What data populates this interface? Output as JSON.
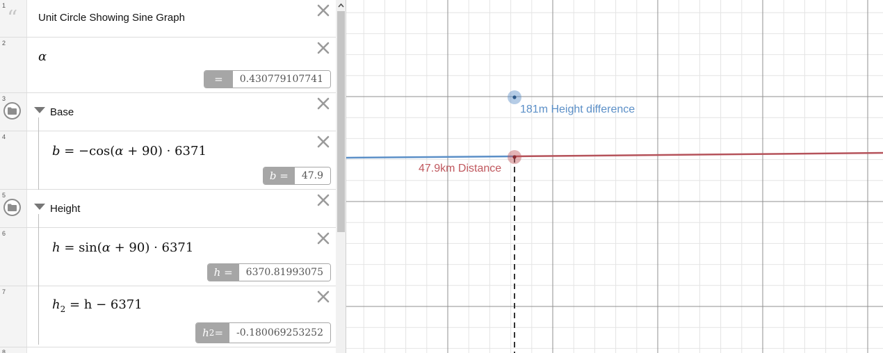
{
  "expressions": {
    "row1": {
      "number": "1",
      "note": "Unit Circle Showing Sine Graph"
    },
    "row2": {
      "number": "2",
      "var": "α",
      "eval_label": "=",
      "eval_value": "0.430779107741"
    },
    "row3": {
      "number": "3",
      "folder_title": "Base"
    },
    "row4": {
      "number": "4",
      "lhs": "b",
      "eq": " = −cos(",
      "alpha": "α",
      "rest": " + 90) · 6371",
      "eval_label": "b =",
      "eval_value": "47.9"
    },
    "row5": {
      "number": "5",
      "folder_title": "Height"
    },
    "row6": {
      "number": "6",
      "lhs": "h",
      "eq": " = sin(",
      "alpha": "α",
      "rest": " + 90) · 6371",
      "eval_label": "h =",
      "eval_value": "6370.81993075"
    },
    "row7": {
      "number": "7",
      "lhs": "h",
      "lhs_sub": "2",
      "rest": " = h − 6371",
      "eval_label_var": "h",
      "eval_label_sub": "2",
      "eval_label_eq": " =",
      "eval_value": "-0.180069253252"
    },
    "row8": {
      "number": "8"
    }
  },
  "graph": {
    "height_label": "181m Height difference",
    "distance_label": "47.9km Distance",
    "colors": {
      "blue": "#5b8fc7",
      "red": "#c0585e",
      "grid_minor": "#e4e4e4",
      "grid_major": "#8f8f8f"
    }
  }
}
